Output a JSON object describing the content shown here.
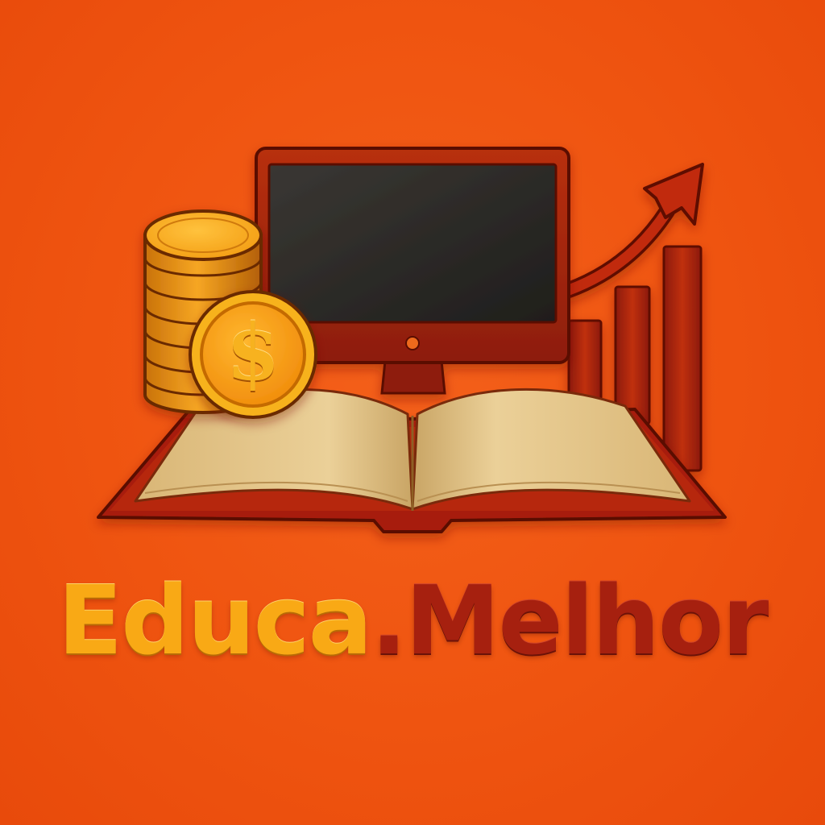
{
  "brand": {
    "name_part_1": "Educa",
    "name_part_2": ".Melhor"
  },
  "logo": {
    "icons": [
      "coin-stack-icon",
      "dollar-coin-icon",
      "monitor-icon",
      "open-book-icon",
      "bar-chart-icon",
      "trend-arrow-icon"
    ],
    "coin_symbol": "$"
  },
  "colors": {
    "background": "#f1520f",
    "gold": "#f9a915",
    "dark_red": "#a6200f",
    "screen": "#2d2b28",
    "page": "#e3c489"
  }
}
